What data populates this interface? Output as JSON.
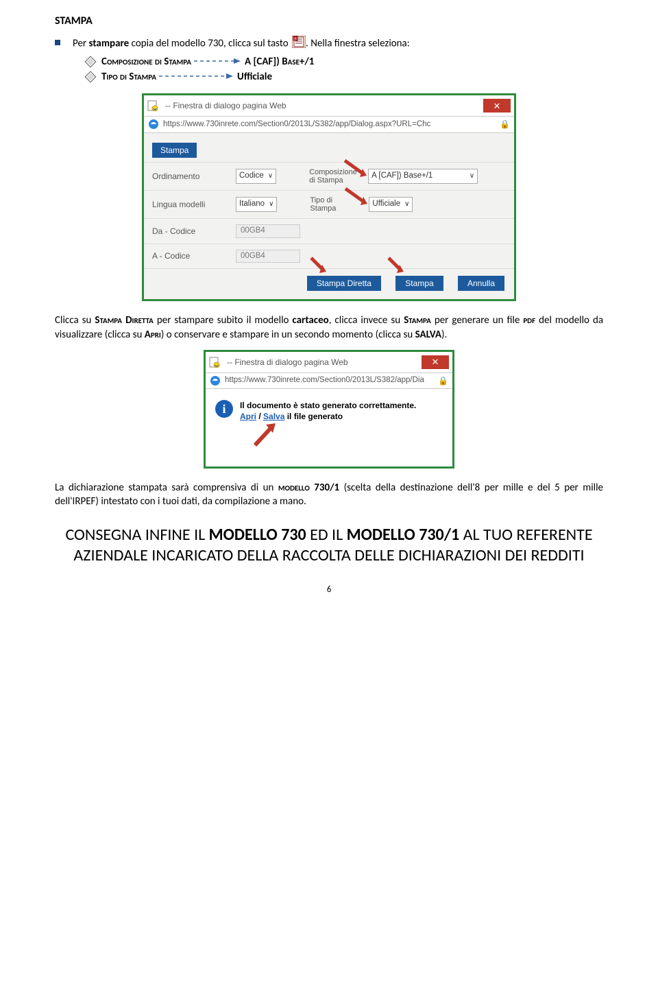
{
  "heading": "STAMPA",
  "bullet_intro_1": "Per ",
  "bullet_intro_2": "stampare",
  "bullet_intro_3": " copia del modello 730, clicca sul tasto ",
  "bullet_tail": ". Nella finestra seleziona:",
  "sublist": {
    "item1_label": "Composizione di Stampa",
    "item1_value": "A [CAF]) Base+/1",
    "item2_label": "Tipo di Stampa",
    "item2_value": "Ufficiale"
  },
  "dialog1": {
    "title": "-- Finestra di dialogo pagina Web",
    "url": "https://www.730inrete.com/Section0/2013L/S382/app/Dialog.aspx?URL=Chc",
    "tab": "Stampa",
    "rows": {
      "ordinamento_label": "Ordinamento",
      "ordinamento_val": "Codice",
      "comp_label": "Composizione\ndi Stampa",
      "comp_val": "A [CAF]) Base+/1",
      "lingua_label": "Lingua modelli",
      "lingua_val": "Italiano",
      "tipo_label": "Tipo di\nStampa",
      "tipo_val": "Ufficiale",
      "da_label": "Da - Codice",
      "da_val": "00GB4",
      "a_label": "A - Codice",
      "a_val": "00GB4"
    },
    "buttons": {
      "diretta": "Stampa Diretta",
      "stampa": "Stampa",
      "annulla": "Annulla"
    }
  },
  "para1": "Clicca su STAMPA DIRETTA per stampare subito il modello cartaceo, clicca invece su STAMPA per generare un file PDF del modello da visualizzare (clicca su APRI) o conservare e stampare in un secondo momento (clicca su SALVA).",
  "dialog2": {
    "title": "-- Finestra di dialogo pagina Web",
    "url": "https://www.730inrete.com/Section0/2013L/S382/app/Dia",
    "msg_line1": "Il documento è stato generato correttamente.",
    "msg_link_apri": "Apri",
    "msg_sep": " / ",
    "msg_link_salva": "Salva",
    "msg_tail": " il file generato"
  },
  "para2": "La dichiarazione stampata sarà comprensiva di un MODELLO 730/1 (scelta della destinazione dell'8 per mille e del 5 per mille dell'IRPEF) intestato con i tuoi dati, da compilazione a mano.",
  "final1": "CONSEGNA INFINE IL ",
  "final2": "MODELLO 730",
  "final3": " ED IL ",
  "final4": "MODELLO 730/1",
  "final5": " AL TUO REFERENTE AZIENDALE INCARICATO DELLA RACCOLTA DELLE DICHIARAZIONI DEI REDDITI",
  "page_num": "6"
}
